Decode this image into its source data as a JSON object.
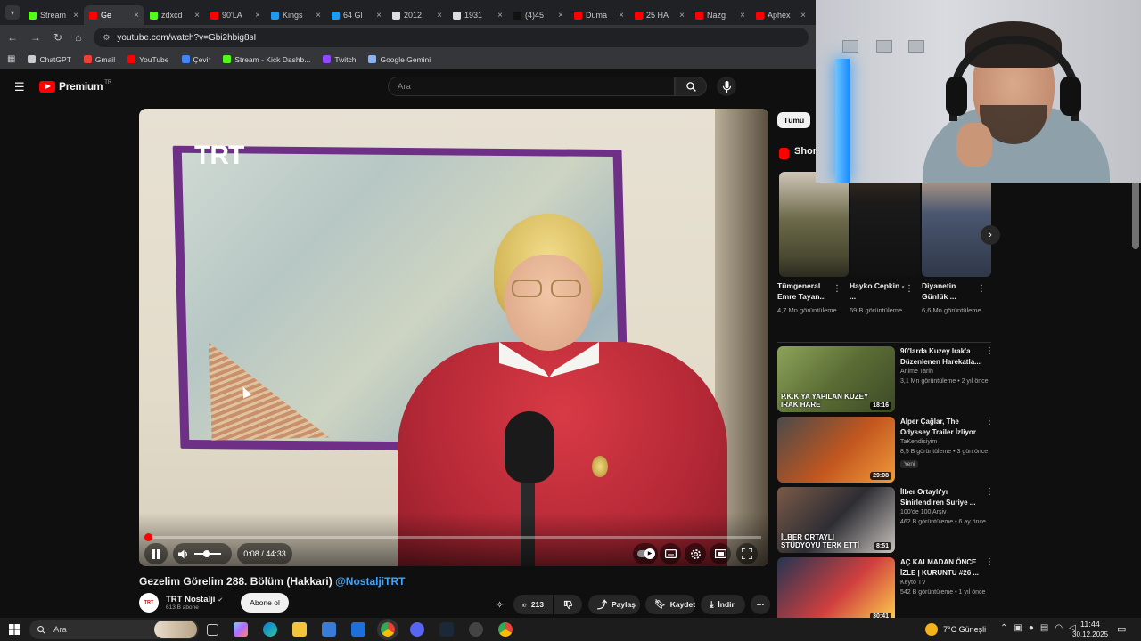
{
  "browser": {
    "tabs": [
      {
        "label": "Stream",
        "fav": "#53fc18",
        "active": false
      },
      {
        "label": "Ge",
        "fav": "#ff0000",
        "active": true
      },
      {
        "label": "zdxcd",
        "fav": "#53fc18",
        "active": false
      },
      {
        "label": "90'LA",
        "fav": "#ff0000",
        "active": false
      },
      {
        "label": "Kings",
        "fav": "#1d9bf0",
        "active": false
      },
      {
        "label": "64 Gl",
        "fav": "#1d9bf0",
        "active": false
      },
      {
        "label": "2012",
        "fav": "#dddddd",
        "active": false
      },
      {
        "label": "1931",
        "fav": "#dddddd",
        "active": false
      },
      {
        "label": "(4)45",
        "fav": "#111111",
        "active": false
      },
      {
        "label": "Duma",
        "fav": "#ff0000",
        "active": false
      },
      {
        "label": "25 HA",
        "fav": "#ff0000",
        "active": false
      },
      {
        "label": "Nazg",
        "fav": "#ff0000",
        "active": false
      },
      {
        "label": "Aphex",
        "fav": "#ff0000",
        "active": false
      }
    ],
    "url": "youtube.com/watch?v=Gbi2hbig8sI",
    "bookmarks": [
      {
        "label": "ChatGPT",
        "color": "#cccccc"
      },
      {
        "label": "Gmail",
        "color": "#ea4335"
      },
      {
        "label": "YouTube",
        "color": "#ff0000"
      },
      {
        "label": "Çevir",
        "color": "#4285f4"
      },
      {
        "label": "Stream - Kick Dashb...",
        "color": "#53fc18"
      },
      {
        "label": "Twitch",
        "color": "#9146ff"
      },
      {
        "label": "Google Gemini",
        "color": "#8ab4f8"
      }
    ]
  },
  "youtube": {
    "brand": "Premium",
    "region": "TR",
    "search_placeholder": "Ara"
  },
  "player": {
    "watermark": "TRT",
    "time": "0:08 / 44:33",
    "progress": 0.003
  },
  "video": {
    "title": "Gezelim Görelim 288. Bölüm (Hakkari)",
    "hashtag": "@NostaljiTRT",
    "channel": "TRT Nostalji",
    "channel_avatar": "TRT",
    "subscribers": "613 B abone",
    "subscribe_label": "Abone ol",
    "likes": "213",
    "share_label": "Paylaş",
    "save_label": "Kaydet",
    "download_label": "İndir"
  },
  "sidebar": {
    "chip": "Tümü",
    "shorts_label": "Shor",
    "shorts": [
      {
        "title": "Tümgeneral Emre Tayan...",
        "views": "4,7 Mn görüntüleme"
      },
      {
        "title": "Hayko Cepkin - ...",
        "views": "69 B görüntüleme"
      },
      {
        "title": "Diyanetin Günlük ...",
        "views": "6,6 Mn görüntüleme"
      }
    ],
    "videos": [
      {
        "title": "90'larda Kuzey Irak'a Düzenlenen Harekatla...",
        "channel": "Anime Tarih",
        "meta": "3,1 Mn görüntüleme • 2 yıl önce",
        "duration": "18:16",
        "thumb_text": "P.K.K YA YAPILAN KUZEY IRAK HARE",
        "badge": ""
      },
      {
        "title": "Alper Çağlar, The Odyssey Trailer İzliyor",
        "channel": "TaKendisiyim",
        "meta": "8,5 B görüntüleme • 3 gün önce",
        "duration": "29:08",
        "thumb_text": "",
        "badge": "Yeni"
      },
      {
        "title": "İlber Ortaylı'yı Sinirlendiren Suriye ...",
        "channel": "100'de 100 Arşiv",
        "meta": "462 B görüntüleme • 6 ay önce",
        "duration": "8:51",
        "thumb_text": "İLBER ORTAYLI STÜDYOYU TERK ETTİ",
        "badge": ""
      },
      {
        "title": "AÇ KALMADAN ÖNCE İZLE | KURUNTU #26 ...",
        "channel": "Keyto TV",
        "meta": "542 B görüntüleme • 1 yıl önce",
        "duration": "30:41",
        "thumb_text": "",
        "badge": ""
      }
    ]
  },
  "taskbar": {
    "search_label": "Ara",
    "weather": "7°C  Güneşli",
    "time": "11:44",
    "date": "30.12.2025"
  }
}
